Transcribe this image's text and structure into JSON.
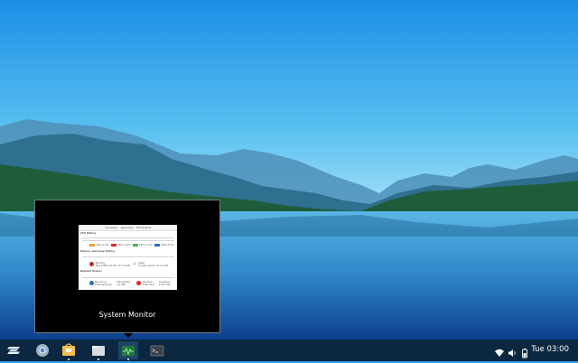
{
  "taskbar": {
    "clock": "Tue 03:00",
    "apps": [
      {
        "name": "zorin-menu-icon"
      },
      {
        "name": "chrome-icon"
      },
      {
        "name": "software-icon"
      },
      {
        "name": "files-icon"
      },
      {
        "name": "system-monitor-icon"
      },
      {
        "name": "terminal-icon"
      }
    ],
    "tray": [
      "wifi-icon",
      "volume-icon",
      "battery-icon"
    ]
  },
  "preview": {
    "title": "System Monitor",
    "thumbnail": {
      "tabs": [
        "Processes",
        "Resources",
        "File Systems"
      ],
      "cpu_header": "CPU History",
      "cpu_labels": [
        "CPU1 2.4%",
        "CPU2 1.8%",
        "CPU3 1.2%",
        "CPU4 0.5%"
      ],
      "mem_header": "Memory and Swap History",
      "memory_label": "Memory",
      "memory_value": "661.9 MiB (19.8%) of 3.5 GiB",
      "swap_label": "Swap",
      "swap_value": "0 bytes (0.0%) of 1.6 GiB",
      "net_header": "Network History",
      "receiving_label": "Receiving",
      "receiving_rate": "190 bytes/s",
      "total_received_label": "Total Received",
      "total_received": "1.9 MiB",
      "sending_label": "Sending",
      "sending_rate": "0 bytes/s",
      "total_sent_label": "Total Sent",
      "total_sent": "179.2 KiB"
    }
  },
  "colors": {
    "taskbar": "#0c2740",
    "sky_top": "#1e90e6",
    "sky_bottom": "#8fd8f5",
    "water": "#2f86c9",
    "cpu1": "#e8a03a",
    "cpu2": "#d82c2c",
    "cpu3": "#4eb34a",
    "cpu4": "#2a6fb8"
  }
}
